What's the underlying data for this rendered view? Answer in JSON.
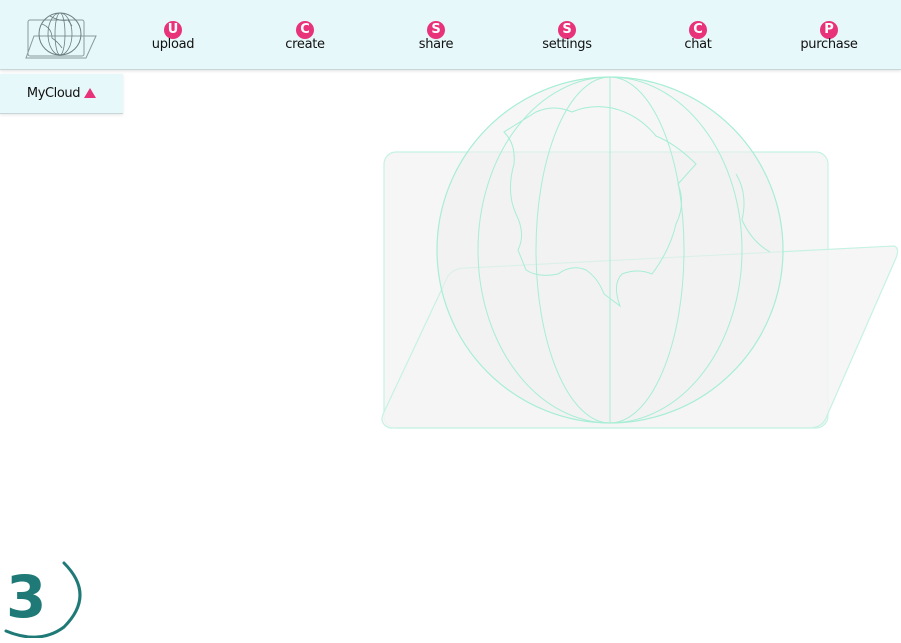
{
  "nav": {
    "items": [
      {
        "badge": "U",
        "label": "upload"
      },
      {
        "badge": "C",
        "label": "create"
      },
      {
        "badge": "S",
        "label": "share"
      },
      {
        "badge": "S",
        "label": "settings"
      },
      {
        "badge": "C",
        "label": "chat"
      },
      {
        "badge": "P",
        "label": "purchase"
      }
    ]
  },
  "tab": {
    "label": "MyCloud",
    "caret_icon": "triangle-up-icon"
  },
  "bottom_logo": {
    "text": "3"
  },
  "colors": {
    "accent": "#e8337a",
    "bar_bg": "#e6f8fa",
    "teal": "#1f7a77",
    "watermark_line": "#8fe8cc"
  }
}
